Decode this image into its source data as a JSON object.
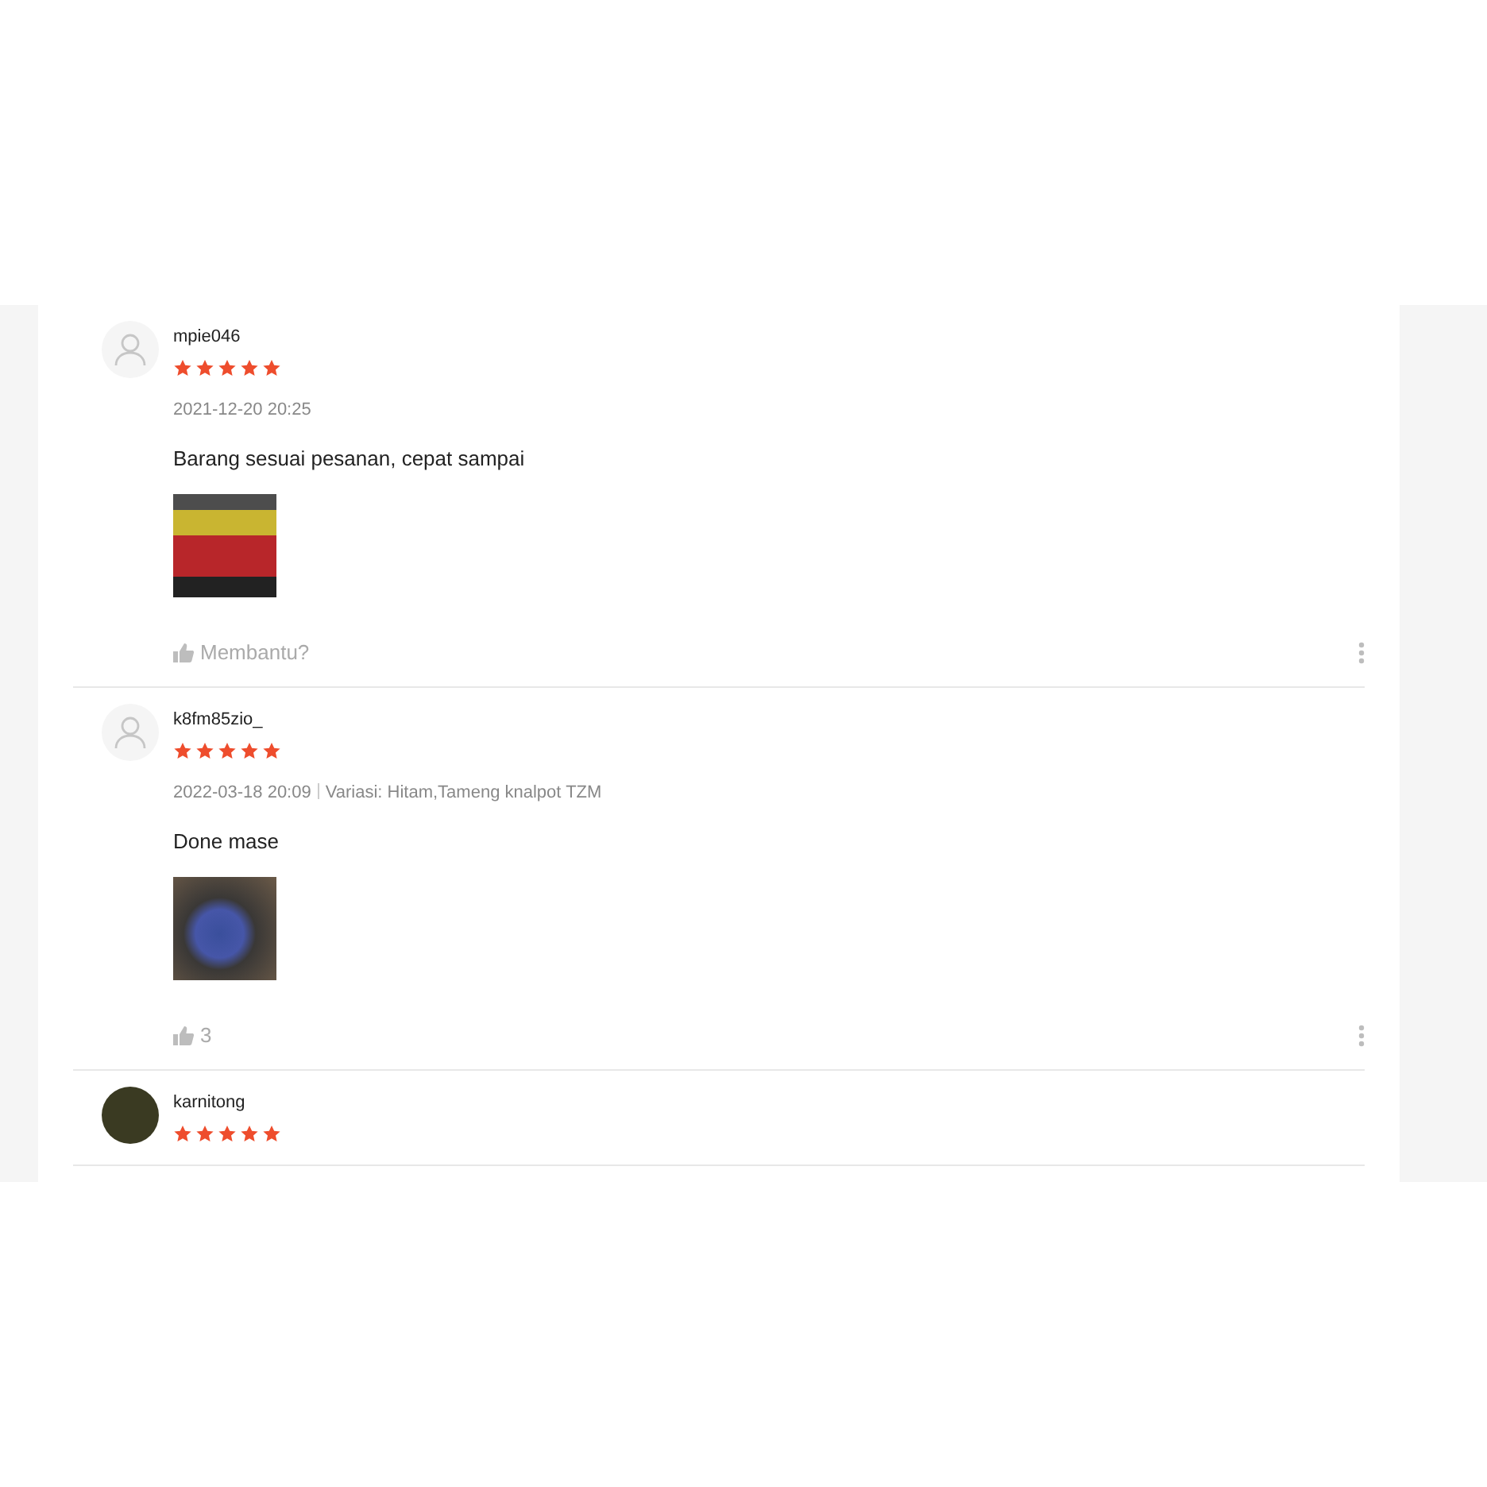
{
  "reviews": [
    {
      "kind": "default-avatar",
      "username": "mpie046",
      "stars": 5,
      "date": "2021-12-20 20:25",
      "text": "Barang sesuai pesanan, cepat sampai",
      "photos": [
        {
          "kind": "parcel"
        }
      ],
      "helpful": "Membantu?"
    },
    {
      "kind": "default-avatar",
      "username": "k8fm85zio_",
      "stars": 5,
      "date": "2022-03-18 20:09",
      "variation": "Variasi: Hitam,Tameng knalpot TZM",
      "text": "Done mase",
      "photos": [
        {
          "kind": "motorbike"
        }
      ],
      "helpful": "3"
    },
    {
      "kind": "photo-avatar",
      "username": "karnitong",
      "stars": 5
    }
  ]
}
